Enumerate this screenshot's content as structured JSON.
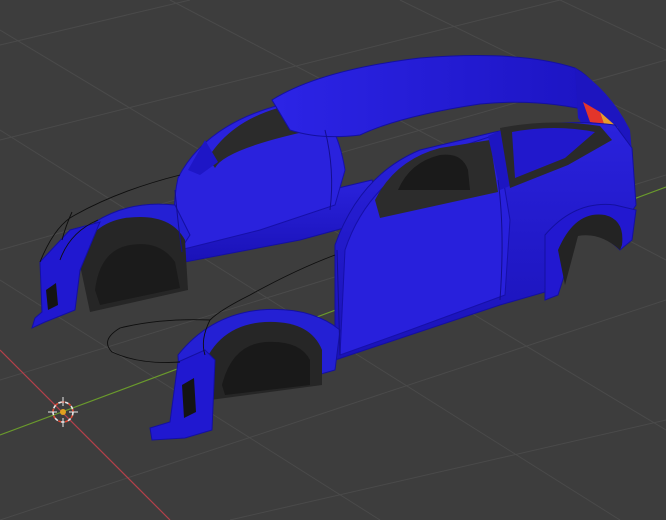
{
  "app": {
    "name": "3D viewport",
    "view": "perspective",
    "shading": "solid"
  },
  "scene": {
    "object": "car-body",
    "paint_color": "#1f17c8",
    "tire_well_color": "#232323",
    "tail_light_colors": [
      "#e3352b",
      "#e79b2a"
    ],
    "has_3d_cursor": true,
    "axes_visible": [
      "x",
      "y"
    ]
  },
  "colors": {
    "background": "#3d3d3d",
    "grid": "#4a4a4a",
    "x_axis": "#b4414a",
    "y_axis": "#6a9a2c",
    "cursor_ring": "#e6e6e6",
    "cursor_red": "#e04a35",
    "cursor_center": "#e0a020"
  }
}
